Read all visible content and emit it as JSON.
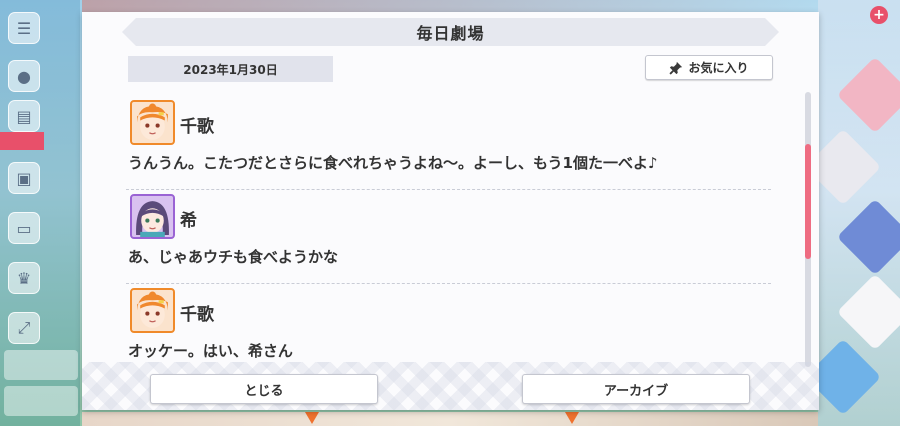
{
  "dialog": {
    "title": "毎日劇場",
    "date": "2023年1月30日",
    "favorite_label": "お気に入り",
    "close_label": "とじる",
    "archive_label": "アーカイブ"
  },
  "entries": [
    {
      "speaker": "千歌",
      "text": "うんうん。こたつだとさらに食べれちゃうよね〜。よーし、もう1個た一べよ♪",
      "avatar": "chika-avatar"
    },
    {
      "speaker": "希",
      "text": "あ、じゃあウチも食べようかな",
      "avatar": "nozomi-avatar"
    },
    {
      "speaker": "千歌",
      "text": "オッケー。はい、希さん",
      "avatar": "chika-avatar"
    }
  ],
  "scroll": {
    "position_fraction": 0.25
  },
  "colors": {
    "accent": "#ee6c82",
    "chika_frame": "#f08a2a",
    "nozomi_frame": "#9a63d4"
  }
}
